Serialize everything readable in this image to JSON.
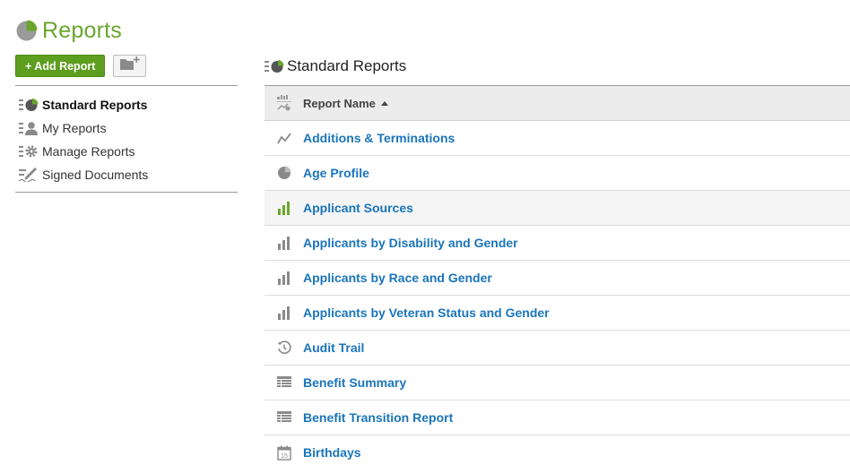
{
  "header": {
    "title": "Reports",
    "logo_icon": "pie-chart-icon",
    "accent": "#6aa62c"
  },
  "toolbar": {
    "add_label": "+ Add Report",
    "folder_icon": "folder-add-icon"
  },
  "sidebar": {
    "items": [
      {
        "label": "Standard Reports",
        "icon": "standard-reports-icon",
        "active": true
      },
      {
        "label": "My Reports",
        "icon": "my-reports-icon",
        "active": false
      },
      {
        "label": "Manage Reports",
        "icon": "manage-reports-icon",
        "active": false
      },
      {
        "label": "Signed Documents",
        "icon": "signed-documents-icon",
        "active": false
      }
    ]
  },
  "main": {
    "title": "Standard Reports",
    "table": {
      "column_header": "Report Name",
      "sort": "ascending",
      "rows": [
        {
          "name": "Additions & Terminations",
          "icon": "line-chart-icon"
        },
        {
          "name": "Age Profile",
          "icon": "pie-chart-icon"
        },
        {
          "name": "Applicant Sources",
          "icon": "bar-chart-icon",
          "highlight": true
        },
        {
          "name": "Applicants by Disability and Gender",
          "icon": "bar-chart-icon"
        },
        {
          "name": "Applicants by Race and Gender",
          "icon": "bar-chart-icon"
        },
        {
          "name": "Applicants by Veteran Status and Gender",
          "icon": "bar-chart-icon"
        },
        {
          "name": "Audit Trail",
          "icon": "history-icon"
        },
        {
          "name": "Benefit Summary",
          "icon": "table-icon"
        },
        {
          "name": "Benefit Transition Report",
          "icon": "table-icon"
        },
        {
          "name": "Birthdays",
          "icon": "calendar-icon",
          "calendar_day": "15"
        }
      ]
    }
  },
  "colors": {
    "link": "#1a75bb",
    "button_green": "#5e9e1f",
    "icon_gray": "#8a8a8a",
    "icon_green": "#6aa62c"
  }
}
